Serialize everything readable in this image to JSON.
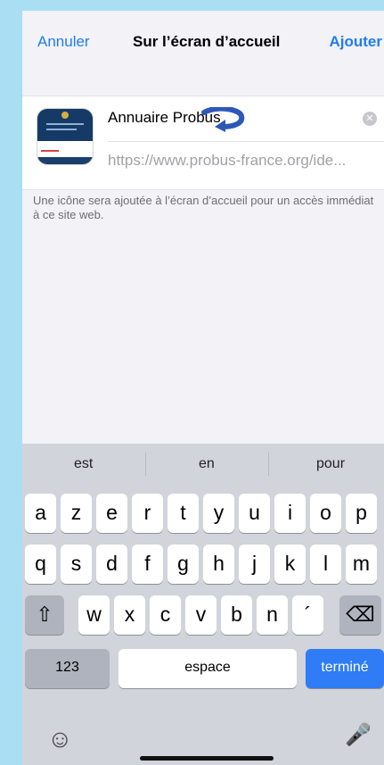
{
  "nav": {
    "cancel": "Annuler",
    "title": "Sur l’écran d’accueil",
    "add": "Ajouter"
  },
  "form": {
    "name_value": "Annuaire Probus",
    "url": "https://www.probus-france.org/ide...",
    "hint": "Une icône sera ajoutée à l’écran d’accueil pour un accès immédiat à ce site web."
  },
  "keyboard": {
    "suggestions": [
      "est",
      "en",
      "pour"
    ],
    "row1": [
      "a",
      "z",
      "e",
      "r",
      "t",
      "y",
      "u",
      "i",
      "o",
      "p"
    ],
    "row2": [
      "q",
      "s",
      "d",
      "f",
      "g",
      "h",
      "j",
      "k",
      "l",
      "m"
    ],
    "row3": [
      "w",
      "x",
      "c",
      "v",
      "b",
      "n",
      "´"
    ],
    "numbers": "123",
    "space": "espace",
    "done": "terminé"
  },
  "colors": {
    "accent": "#1e7cf2",
    "background": "#a9def3",
    "done_key": "#2f7cf6"
  },
  "icons": {
    "shift": "shift-icon",
    "delete": "backspace-icon",
    "emoji": "emoji-icon",
    "mic": "microphone-icon",
    "clear": "clear-icon",
    "annotation": "curved-arrow-icon"
  }
}
